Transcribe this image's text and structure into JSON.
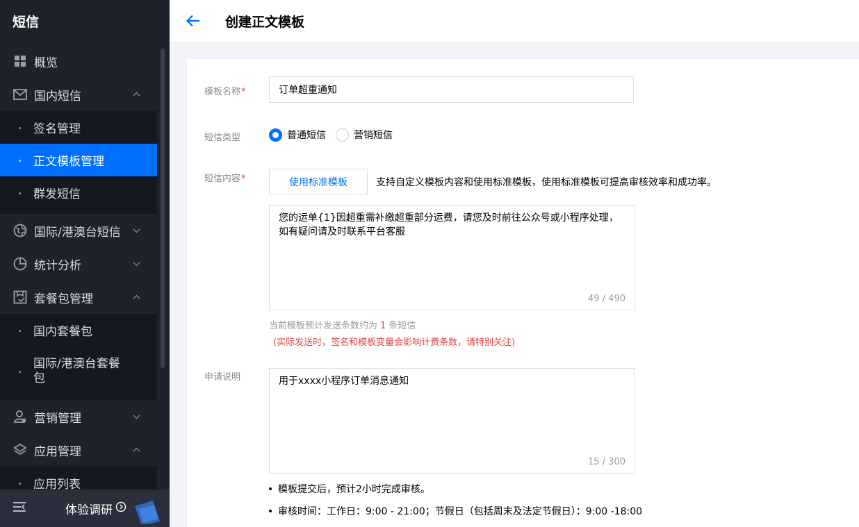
{
  "sidebar": {
    "title": "短信",
    "menu": {
      "overview": "概览",
      "domestic": "国内短信",
      "domestic_sub": {
        "sign": "签名管理",
        "template": "正文模板管理",
        "bulk": "群发短信"
      },
      "intl": "国际/港澳台短信",
      "stats": "统计分析",
      "packages": "套餐包管理",
      "packages_sub": {
        "domestic": "国内套餐包",
        "intl": "国际/港澳台套餐包"
      },
      "marketing": "营销管理",
      "apps": "应用管理",
      "apps_sub": {
        "list": "应用列表"
      }
    },
    "footer": {
      "feedback": "体验调研"
    }
  },
  "header": {
    "title": "创建正文模板"
  },
  "form": {
    "name_label": "模板名称",
    "required_mark": "*",
    "name_value": "订单超重通知",
    "type_label": "短信类型",
    "type_options": [
      "普通短信",
      "营销短信"
    ],
    "type_selected": "普通短信",
    "content_label": "短信内容",
    "std_template_button": "使用标准模板",
    "std_template_hint": "支持自定义模板内容和使用标准模板，使用标准模板可提高审核效率和成功率。",
    "content_value": "您的运单{1}因超重需补缴超重部分运费，请您及时前往公众号或小程序处理，如有疑问请及时联系平台客服",
    "content_count": "49 / 490",
    "estimate_prefix": "当前模板预计发送条数约为",
    "estimate_num": "1",
    "estimate_suffix": "条短信",
    "estimate_warning": "(实际发送时，签名和模板变量会影响计费条数，请特别关注)",
    "note_label": "申请说明",
    "note_value": "用于xxxx小程序订单消息通知",
    "note_count": "15 / 300",
    "tips": [
      "模板提交后，预计2小时完成审核。",
      "审核时间：工作日：9:00 - 21:00；节假日（包括周末及法定节假日）：9:00 -18:00"
    ]
  },
  "colors": {
    "primary": "#006eff",
    "sidebar_bg": "#1e222d",
    "danger": "#e54545"
  },
  "icons": [
    "grid-icon",
    "mail-icon",
    "globe-icon",
    "pie-chart-icon",
    "package-icon",
    "user-icon",
    "layers-icon",
    "menu-collapse-icon",
    "arrow-circle-icon",
    "back-arrow-icon"
  ]
}
